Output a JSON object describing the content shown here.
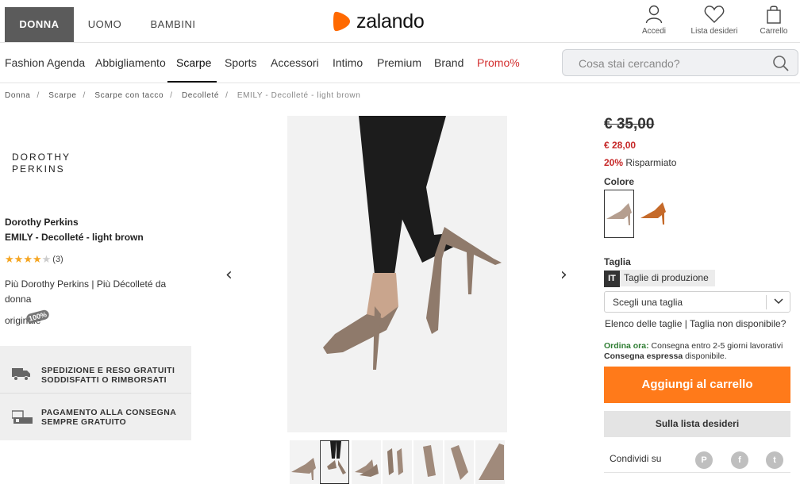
{
  "gender_tabs": [
    {
      "label": "DONNA"
    },
    {
      "label": "UOMO"
    },
    {
      "label": "BAMBINI"
    }
  ],
  "logo": {
    "text": "zalando"
  },
  "top_icons": [
    {
      "label": "Accedi",
      "icon": "user-icon"
    },
    {
      "label": "Lista desideri",
      "icon": "heart-icon"
    },
    {
      "label": "Carrello",
      "icon": "bag-icon"
    }
  ],
  "nav": [
    {
      "label": "Fashion Agenda"
    },
    {
      "label": "Abbigliamento"
    },
    {
      "label": "Scarpe"
    },
    {
      "label": "Sports"
    },
    {
      "label": "Accessori"
    },
    {
      "label": "Intimo"
    },
    {
      "label": "Premium"
    },
    {
      "label": "Brand"
    },
    {
      "label": "Promo%"
    }
  ],
  "search": {
    "placeholder": "Cosa stai cercando?"
  },
  "breadcrumb": [
    "Donna",
    "Scarpe",
    "Scarpe con tacco",
    "Decolleté",
    "EMILY - Decolleté - light brown"
  ],
  "product": {
    "brand_logo_line1": "DOROTHY",
    "brand_logo_line2": "PERKINS",
    "brand": "Dorothy Perkins",
    "name": "EMILY - Decolleté - light brown",
    "rating_stars": 4,
    "rating_count": "(3)",
    "more_text": "Più Dorothy Perkins | Più Décolleté da donna",
    "original_label": "originale",
    "original_badge": "100%"
  },
  "services": [
    {
      "text": "SPEDIZIONE E RESO GRATUITI SODDISFATTI O RIMBORSATI",
      "icon": "truck-icon"
    },
    {
      "text": "PAGAMENTO ALLA CONSEGNA SEMPRE GRATUITO",
      "icon": "cash-icon"
    }
  ],
  "gallery": {
    "prev": "‹",
    "next": "›",
    "thumb_count": 7,
    "selected_thumb": 1
  },
  "price": {
    "old": "€ 35,00",
    "new": "€ 28,00",
    "discount": "20%",
    "discount_label": "Risparmiato"
  },
  "colors": {
    "label": "Colore",
    "options": [
      {
        "name": "light brown",
        "color": "#b59e8f"
      },
      {
        "name": "tan",
        "color": "#c56a2a"
      }
    ],
    "selected": 0
  },
  "size": {
    "label": "Taglia",
    "region": "IT",
    "region_label": "Taglie di produzione",
    "select_placeholder": "Scegli una taglia",
    "links": "Elenco delle taglie | Taglia non disponibile?"
  },
  "delivery": {
    "order_now": "Ordina ora:",
    "standard": "Consegna entro 2-5 giorni lavorativi",
    "express_label": "Consegna espressa",
    "express_status": "disponibile."
  },
  "buttons": {
    "add_to_cart": "Aggiungi al carrello",
    "wishlist": "Sulla lista desideri"
  },
  "share": {
    "label": "Condividi su",
    "networks": [
      "pinterest-icon",
      "facebook-icon",
      "twitter-icon"
    ]
  },
  "colors_theme": {
    "accent": "#ff6900",
    "promo": "#d32f2f",
    "price_sale": "#c62828",
    "add_to_cart": "#ff7a1a"
  }
}
